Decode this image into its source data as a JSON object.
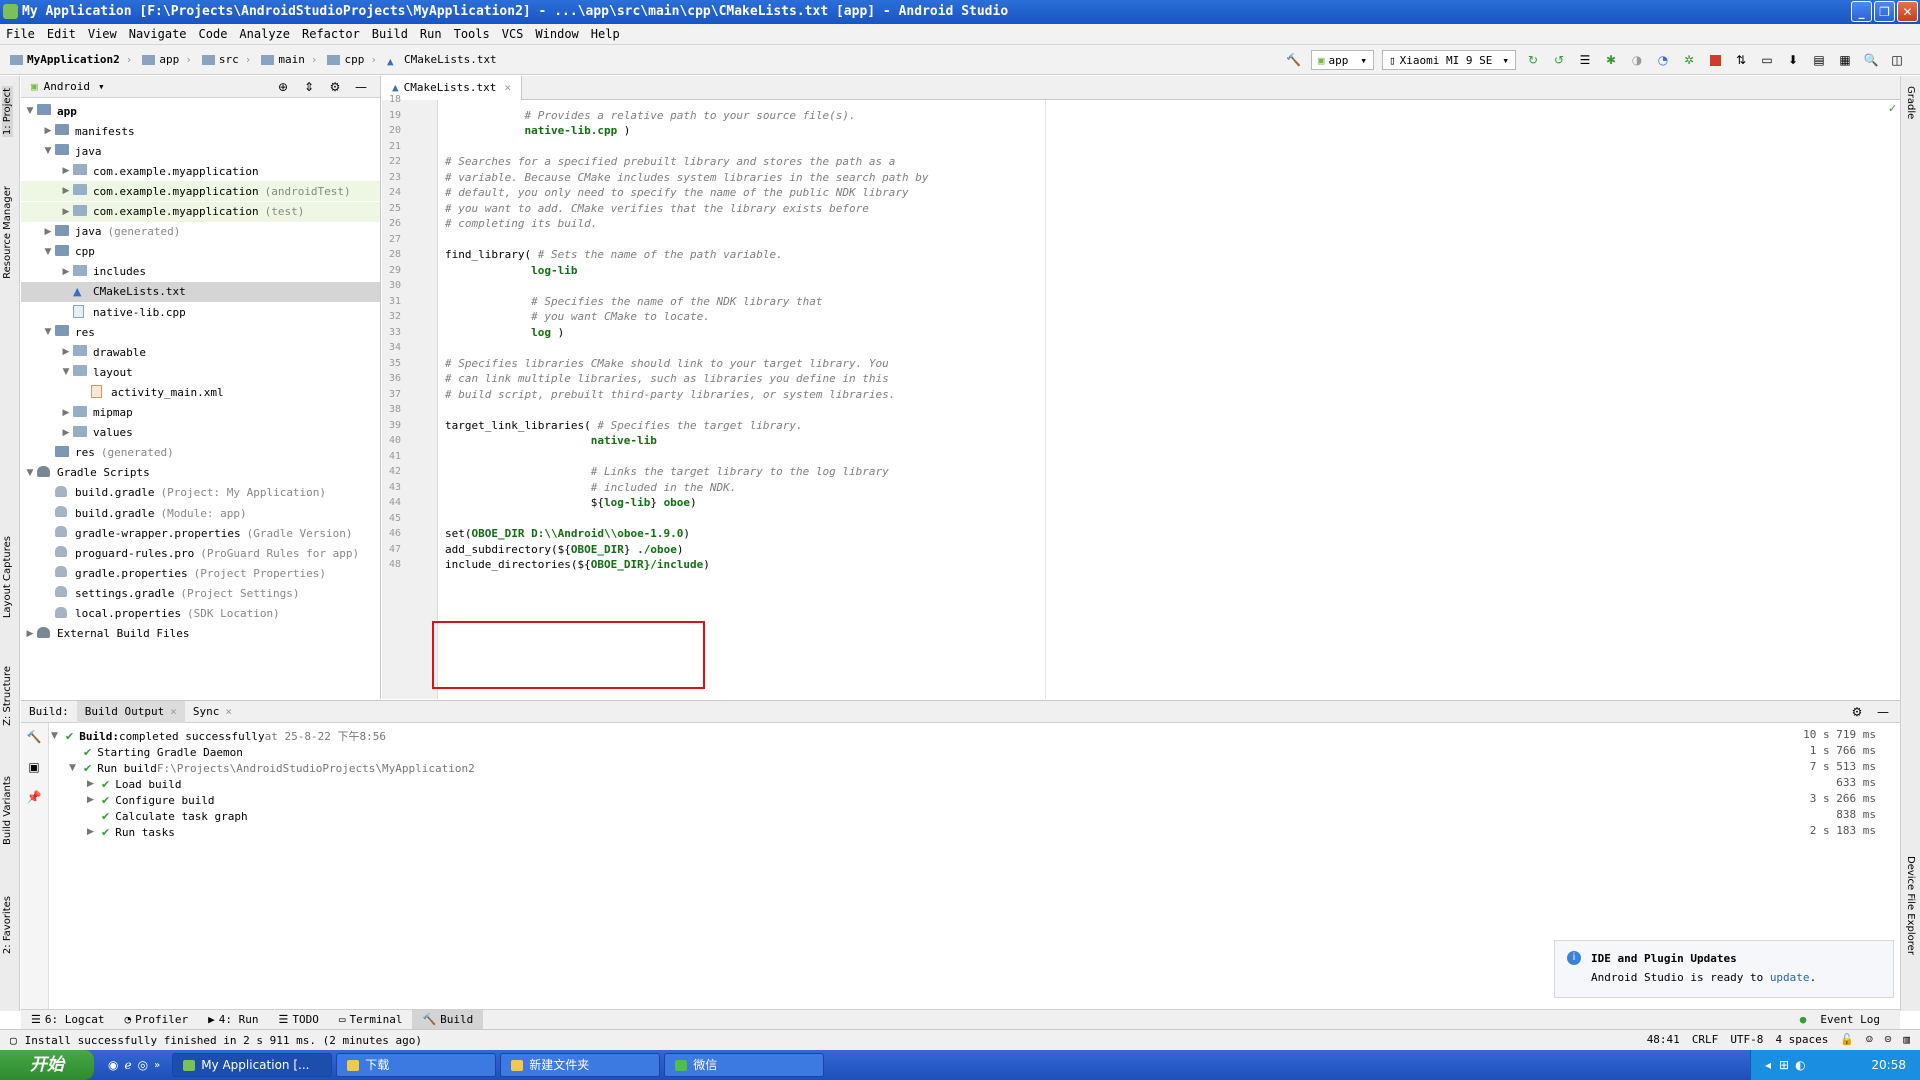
{
  "window": {
    "title": "My Application [F:\\Projects\\AndroidStudioProjects\\MyApplication2] - ...\\app\\src\\main\\cpp\\CMakeLists.txt [app] - Android Studio"
  },
  "menu": [
    "File",
    "Edit",
    "View",
    "Navigate",
    "Code",
    "Analyze",
    "Refactor",
    "Build",
    "Run",
    "Tools",
    "VCS",
    "Window",
    "Help"
  ],
  "breadcrumb": [
    "MyApplication2",
    "app",
    "src",
    "main",
    "cpp",
    "CMakeLists.txt"
  ],
  "toolbar": {
    "config": "app",
    "device": "Xiaomi MI 9 SE"
  },
  "left_strip": {
    "project": "1: Project",
    "resource": "Resource Manager",
    "layout": "Layout Captures",
    "structure": "Z: Structure",
    "variants": "Build Variants",
    "favorites": "2: Favorites"
  },
  "right_strip": {
    "gradle": "Gradle",
    "device_explorer": "Device File Explorer"
  },
  "project": {
    "view": "Android",
    "items": [
      {
        "label": "app",
        "indent": 0,
        "arrow": "▼",
        "bold": true
      },
      {
        "label": "manifests",
        "indent": 1,
        "arrow": "▶"
      },
      {
        "label": "java",
        "indent": 1,
        "arrow": "▼"
      },
      {
        "label": "com.example.myapplication",
        "indent": 2,
        "arrow": "▶"
      },
      {
        "label": "com.example.myapplication",
        "indent": 2,
        "arrow": "▶",
        "dim": "(androidTest)",
        "hl": true
      },
      {
        "label": "com.example.myapplication",
        "indent": 2,
        "arrow": "▶",
        "dim": "(test)",
        "hl": true
      },
      {
        "label": "java",
        "indent": 1,
        "arrow": "▶",
        "dim": "(generated)"
      },
      {
        "label": "cpp",
        "indent": 1,
        "arrow": "▼"
      },
      {
        "label": "includes",
        "indent": 2,
        "arrow": "▶"
      },
      {
        "label": "CMakeLists.txt",
        "indent": 2,
        "arrow": "",
        "sel": true
      },
      {
        "label": "native-lib.cpp",
        "indent": 2,
        "arrow": ""
      },
      {
        "label": "res",
        "indent": 1,
        "arrow": "▼"
      },
      {
        "label": "drawable",
        "indent": 2,
        "arrow": "▶"
      },
      {
        "label": "layout",
        "indent": 2,
        "arrow": "▼"
      },
      {
        "label": "activity_main.xml",
        "indent": 3,
        "arrow": ""
      },
      {
        "label": "mipmap",
        "indent": 2,
        "arrow": "▶"
      },
      {
        "label": "values",
        "indent": 2,
        "arrow": "▶"
      },
      {
        "label": "res",
        "indent": 1,
        "arrow": "",
        "dim": "(generated)"
      },
      {
        "label": "Gradle Scripts",
        "indent": 0,
        "arrow": "▼"
      },
      {
        "label": "build.gradle",
        "indent": 1,
        "arrow": "",
        "dim": "(Project: My Application)"
      },
      {
        "label": "build.gradle",
        "indent": 1,
        "arrow": "",
        "dim": "(Module: app)"
      },
      {
        "label": "gradle-wrapper.properties",
        "indent": 1,
        "arrow": "",
        "dim": "(Gradle Version)"
      },
      {
        "label": "proguard-rules.pro",
        "indent": 1,
        "arrow": "",
        "dim": "(ProGuard Rules for app)"
      },
      {
        "label": "gradle.properties",
        "indent": 1,
        "arrow": "",
        "dim": "(Project Properties)"
      },
      {
        "label": "settings.gradle",
        "indent": 1,
        "arrow": "",
        "dim": "(Project Settings)"
      },
      {
        "label": "local.properties",
        "indent": 1,
        "arrow": "",
        "dim": "(SDK Location)"
      },
      {
        "label": "External Build Files",
        "indent": 0,
        "arrow": "▶"
      }
    ]
  },
  "editor": {
    "tab": "CMakeLists.txt",
    "lines": [
      {
        "n": "18",
        "parts": []
      },
      {
        "n": "19",
        "parts": [
          {
            "t": "            # Provides a relative path to your source file(s).",
            "c": "cm"
          }
        ]
      },
      {
        "n": "20",
        "parts": [
          {
            "t": "            native-lib.cpp",
            "c": "grn"
          },
          {
            "t": " )",
            "c": "fn"
          }
        ]
      },
      {
        "n": "21",
        "parts": []
      },
      {
        "n": "22",
        "parts": [
          {
            "t": "# Searches for a specified prebuilt library and stores the path as a",
            "c": "cm"
          }
        ]
      },
      {
        "n": "23",
        "parts": [
          {
            "t": "# variable. Because CMake includes system libraries in the search path by",
            "c": "cm"
          }
        ]
      },
      {
        "n": "24",
        "parts": [
          {
            "t": "# default, you only need to specify the name of the public NDK library",
            "c": "cm"
          }
        ]
      },
      {
        "n": "25",
        "parts": [
          {
            "t": "# you want to add. CMake verifies that the library exists before",
            "c": "cm"
          }
        ]
      },
      {
        "n": "26",
        "parts": [
          {
            "t": "# completing its build.",
            "c": "cm"
          }
        ]
      },
      {
        "n": "27",
        "parts": []
      },
      {
        "n": "28",
        "parts": [
          {
            "t": "find_library( ",
            "c": "fn"
          },
          {
            "t": "# Sets the name of the path variable.",
            "c": "cm"
          }
        ]
      },
      {
        "n": "29",
        "parts": [
          {
            "t": "             log-lib",
            "c": "grn"
          }
        ]
      },
      {
        "n": "30",
        "parts": []
      },
      {
        "n": "31",
        "parts": [
          {
            "t": "             # Specifies the name of the NDK library that",
            "c": "cm"
          }
        ]
      },
      {
        "n": "32",
        "parts": [
          {
            "t": "             # you want CMake to locate.",
            "c": "cm"
          }
        ]
      },
      {
        "n": "33",
        "parts": [
          {
            "t": "             log",
            "c": "grn"
          },
          {
            "t": " )",
            "c": "fn"
          }
        ]
      },
      {
        "n": "34",
        "parts": []
      },
      {
        "n": "35",
        "parts": [
          {
            "t": "# Specifies libraries CMake should link to your target library. You",
            "c": "cm"
          }
        ]
      },
      {
        "n": "36",
        "parts": [
          {
            "t": "# can link multiple libraries, such as libraries you define in this",
            "c": "cm"
          }
        ]
      },
      {
        "n": "37",
        "parts": [
          {
            "t": "# build script, prebuilt third-party libraries, or system libraries.",
            "c": "cm"
          }
        ]
      },
      {
        "n": "38",
        "parts": []
      },
      {
        "n": "39",
        "parts": [
          {
            "t": "target_link_libraries( ",
            "c": "fn"
          },
          {
            "t": "# Specifies the target library.",
            "c": "cm"
          }
        ]
      },
      {
        "n": "40",
        "parts": [
          {
            "t": "                      native-lib",
            "c": "grn"
          }
        ]
      },
      {
        "n": "41",
        "parts": []
      },
      {
        "n": "42",
        "parts": [
          {
            "t": "                      # Links the target library to the log library",
            "c": "cm"
          }
        ]
      },
      {
        "n": "43",
        "parts": [
          {
            "t": "                      # included in the NDK.",
            "c": "cm"
          }
        ]
      },
      {
        "n": "44",
        "parts": [
          {
            "t": "                      ${",
            "c": "fn"
          },
          {
            "t": "log-lib",
            "c": "grn"
          },
          {
            "t": "} ",
            "c": "fn"
          },
          {
            "t": "oboe",
            "c": "grn"
          },
          {
            "t": ")",
            "c": "fn"
          }
        ]
      },
      {
        "n": "45",
        "parts": []
      },
      {
        "n": "46",
        "parts": [
          {
            "t": "set(",
            "c": "fn"
          },
          {
            "t": "OBOE_DIR D:\\\\Android\\\\oboe-1.9.0",
            "c": "grn"
          },
          {
            "t": ")",
            "c": "fn"
          }
        ]
      },
      {
        "n": "47",
        "parts": [
          {
            "t": "add_subdirectory(${",
            "c": "fn"
          },
          {
            "t": "OBOE_DIR",
            "c": "grn"
          },
          {
            "t": "} ",
            "c": "fn"
          },
          {
            "t": "./oboe",
            "c": "grn"
          },
          {
            "t": ")",
            "c": "fn"
          }
        ]
      },
      {
        "n": "48",
        "parts": [
          {
            "t": "include_directories(${",
            "c": "fn"
          },
          {
            "t": "OBOE_DIR",
            "c": "grn"
          },
          {
            "t": "}/include",
            "c": "grn"
          },
          {
            "t": ")",
            "c": "fn"
          }
        ]
      }
    ]
  },
  "build": {
    "tabs": [
      "Build:",
      "Build Output",
      "Sync"
    ],
    "rows": [
      {
        "indent": 0,
        "arrow": "▼",
        "bold": "Build:",
        "text": " completed successfully",
        "dim": " at 25-8-22 下午8:56",
        "time": "10 s 719 ms"
      },
      {
        "indent": 1,
        "arrow": "",
        "text": "Starting Gradle Daemon",
        "time": "1 s 766 ms"
      },
      {
        "indent": 1,
        "arrow": "▼",
        "text": "Run build",
        "dim": " F:\\Projects\\AndroidStudioProjects\\MyApplication2",
        "time": "7 s 513 ms"
      },
      {
        "indent": 2,
        "arrow": "▶",
        "text": "Load build",
        "time": "633 ms"
      },
      {
        "indent": 2,
        "arrow": "▶",
        "text": "Configure build",
        "time": "3 s 266 ms"
      },
      {
        "indent": 2,
        "arrow": "",
        "text": "Calculate task graph",
        "time": "838 ms"
      },
      {
        "indent": 2,
        "arrow": "▶",
        "text": "Run tasks",
        "time": "2 s 183 ms"
      }
    ]
  },
  "notification": {
    "title": "IDE and Plugin Updates",
    "body": "Android Studio is ready to ",
    "link": "update",
    "end": "."
  },
  "tooltabs": [
    "6: Logcat",
    "Profiler",
    "4: Run",
    "TODO",
    "Terminal",
    "Build"
  ],
  "event_log": "Event Log",
  "status": {
    "message": "Install successfully finished in 2 s 911 ms. (2 minutes ago)",
    "position": "48:41",
    "line_sep": "CRLF",
    "encoding": "UTF-8",
    "indent": "4 spaces"
  },
  "taskbar": {
    "start": "开始",
    "tasks": [
      "My Application [...",
      "下载",
      "新建文件夹",
      "微信"
    ],
    "time": "20:58"
  },
  "colors": {
    "accent": "#2b6fd8",
    "highlight_box": "#e0101a",
    "string_green": "#107010"
  }
}
